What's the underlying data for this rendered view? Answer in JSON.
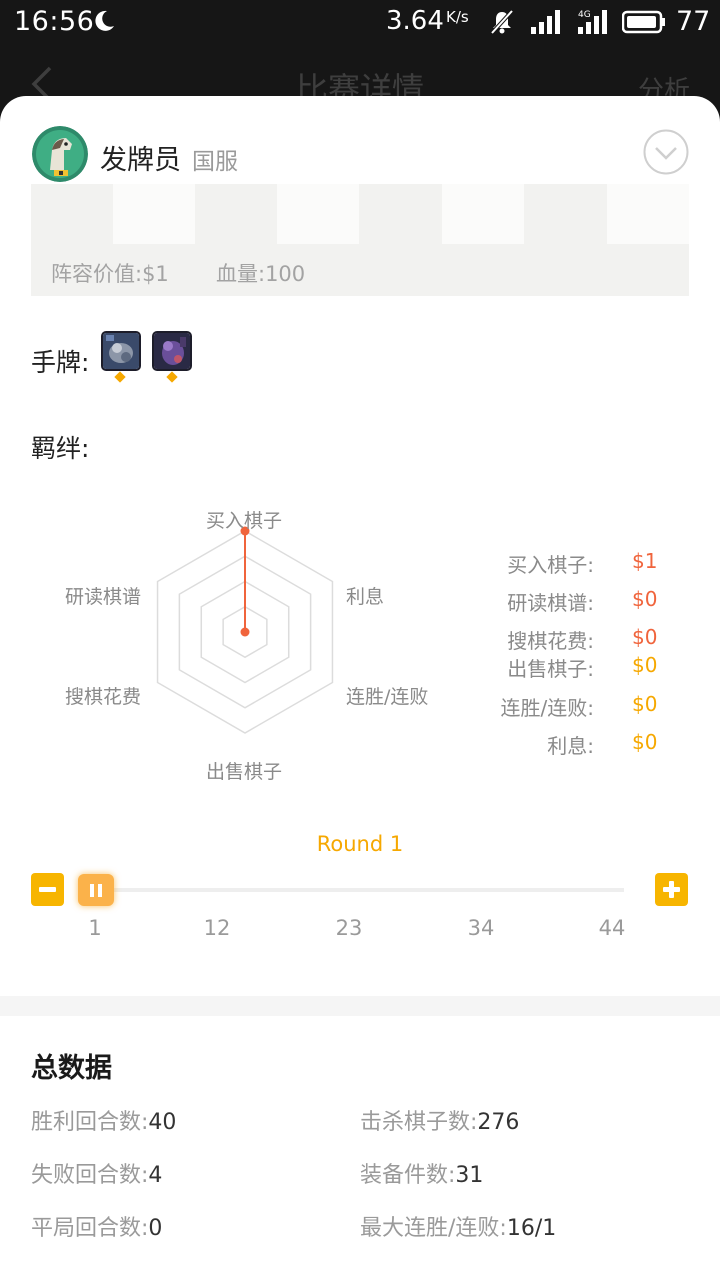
{
  "status_bar": {
    "time": "16:56",
    "net_speed": "3.64",
    "net_speed_unit": "K/s",
    "battery": "77"
  },
  "header": {
    "title": "比赛详情",
    "action": "分析"
  },
  "player": {
    "name": "发牌员",
    "server": "国服"
  },
  "board": {
    "lineup_value": "阵容价值:$1",
    "hp": "血量:100"
  },
  "hand": {
    "label": "手牌:",
    "cards": [
      {
        "name": "hand-card-1",
        "star_color": "#f6a800"
      },
      {
        "name": "hand-card-2",
        "star_color": "#f6a800"
      }
    ]
  },
  "synergy": {
    "label": "羁绊:"
  },
  "radar": {
    "axes": [
      "买入棋子",
      "利息",
      "连胜/连败",
      "出售棋子",
      "搜棋花费",
      "研读棋谱"
    ],
    "values": [
      1,
      0,
      0,
      0,
      0,
      0
    ],
    "max": 1,
    "point_color": "#f0643c"
  },
  "legend": [
    {
      "label": "买入棋子:",
      "value": "$1",
      "color": "#f0643c"
    },
    {
      "label": "研读棋谱:",
      "value": "$0",
      "color": "#f0643c"
    },
    {
      "label": "搜棋花费:",
      "value": "$0",
      "color": "#f0643c"
    },
    {
      "label": "出售棋子:",
      "value": "$0",
      "color": "#f6a800"
    },
    {
      "label": "连胜/连败:",
      "value": "$0",
      "color": "#f6a800"
    },
    {
      "label": "利息:",
      "value": "$0",
      "color": "#f6a800"
    }
  ],
  "round": {
    "label": "Round 1",
    "ticks": [
      "1",
      "12",
      "23",
      "34",
      "44"
    ]
  },
  "totals": {
    "title": "总数据",
    "stats": [
      {
        "label": "胜利回合数:",
        "value": "40"
      },
      {
        "label": "击杀棋子数:",
        "value": "276"
      },
      {
        "label": "失败回合数:",
        "value": "4"
      },
      {
        "label": "装备件数:",
        "value": "31"
      },
      {
        "label": "平局回合数:",
        "value": "0"
      },
      {
        "label": "最大连胜/连败:",
        "value": "16/1"
      }
    ]
  },
  "colors": {
    "accent": "#f6a800",
    "cost_red": "#f0643c"
  }
}
